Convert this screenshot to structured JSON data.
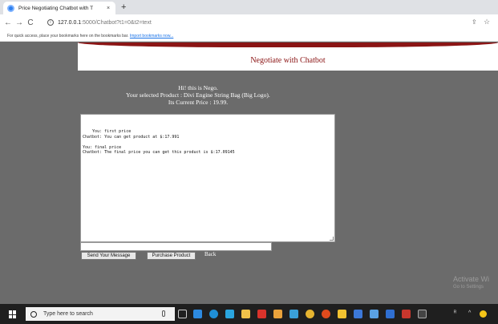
{
  "browser": {
    "tab_title": "Price Negotiating Chatbot with T",
    "tab_close": "×",
    "new_tab": "+",
    "back": "←",
    "forward": "→",
    "reload": "C",
    "url_host": "127.0.0.1",
    "url_path": ":5000/Chatbot?t1=0&t2=text",
    "bookmarks_prompt": "For quick access, place your bookmarks here on the bookmarks bar.",
    "import_link": "Import bookmarks now..."
  },
  "page": {
    "title": "Negotiate with Chatbot",
    "greeting_line1": "Hi! this is Nego.",
    "greeting_line2": "Your selected Product : Divi Engine String Bag (Big Logo).",
    "greeting_line3": "Its Current Price : 19.99.",
    "chat_log": "You: first price\nChatbot: You can get product at $:17.991\n\nYou: final price\nChatbot: The final price you can get this product is $:17.09145",
    "message_input_value": "",
    "send_label": "Send Your Message",
    "purchase_label": "Purchase Product",
    "back_label": "Back"
  },
  "os": {
    "watermark_title": "Activate Wi",
    "watermark_sub": "Go to Settings",
    "search_placeholder": "Type here to search"
  },
  "colors": {
    "brand": "#8b1515",
    "page_bg": "#6b6b6b"
  }
}
